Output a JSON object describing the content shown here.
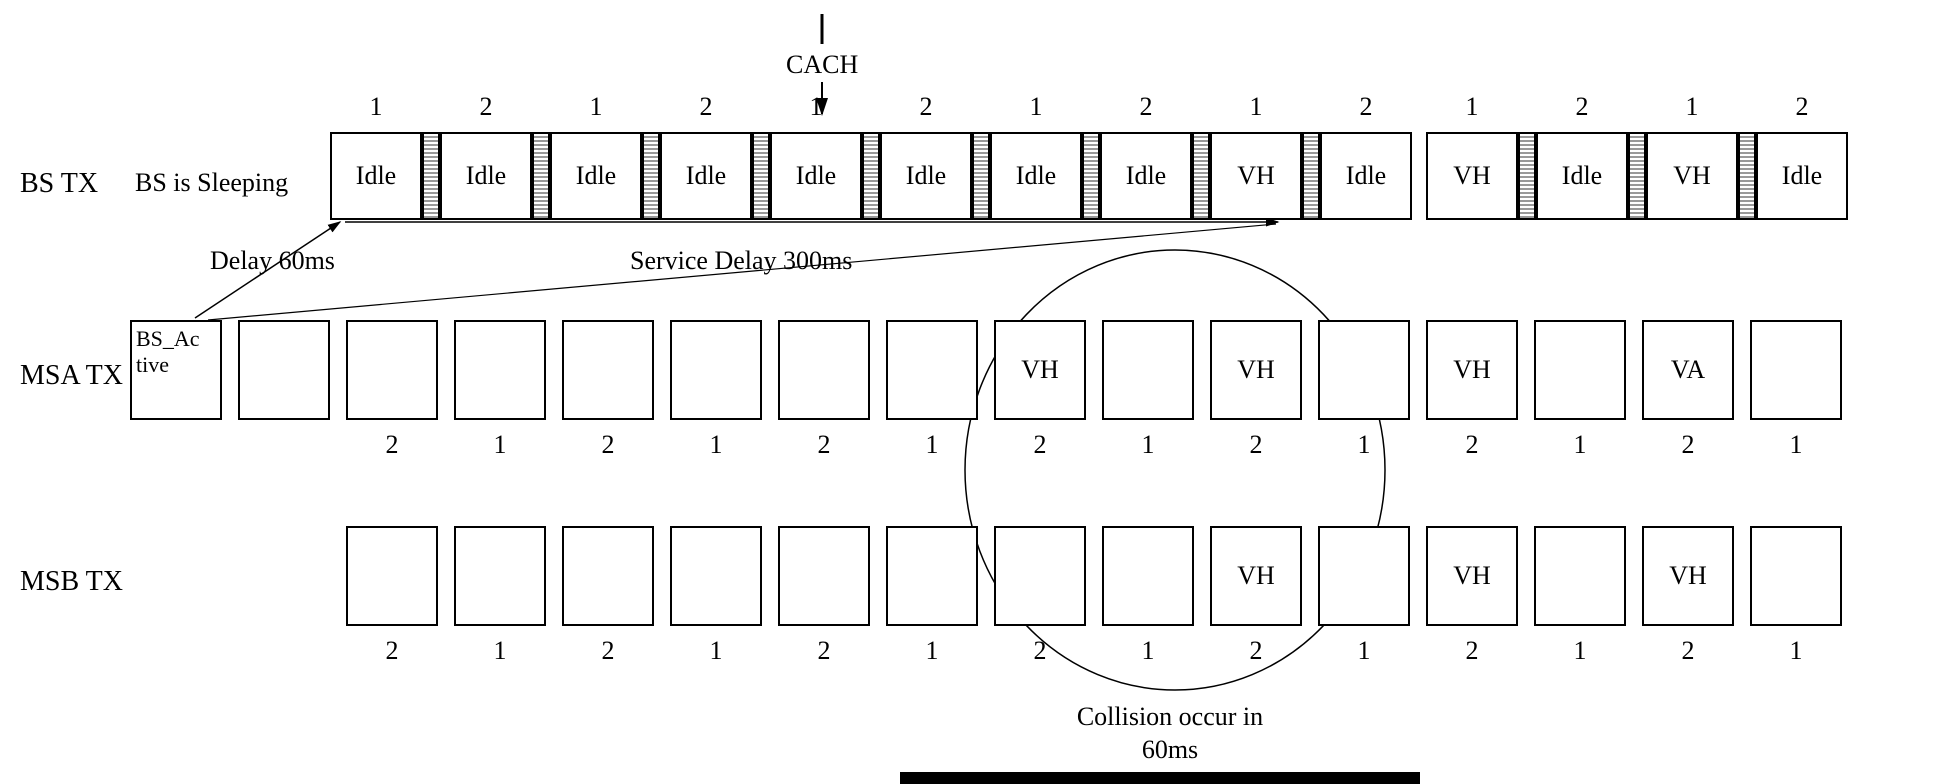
{
  "labels": {
    "bs_tx": "BS TX",
    "bs_sleeping": "BS is Sleeping",
    "msa_tx": "MSA TX",
    "msb_tx": "MSB TX",
    "cach": "CACH",
    "delay60": "Delay 60ms",
    "service_delay": "Service Delay 300ms",
    "collision1": "Collision occur in",
    "collision2": "60ms"
  },
  "bs_row": {
    "top_nums": [
      "1",
      "2",
      "1",
      "2",
      "1",
      "2",
      "1",
      "2",
      "1",
      "2",
      "1",
      "2",
      "1",
      "2"
    ],
    "slots": [
      "Idle",
      "Idle",
      "Idle",
      "Idle",
      "Idle",
      "Idle",
      "Idle",
      "Idle",
      "VH",
      "Idle",
      "VH",
      "Idle",
      "VH",
      "Idle"
    ]
  },
  "msa_row": {
    "bottom_nums": [
      "2",
      "1",
      "2",
      "1",
      "2",
      "1",
      "2",
      "1",
      "2",
      "1",
      "2",
      "1",
      "2",
      "1"
    ],
    "slots": [
      "BS_Ac\ntive",
      "",
      "",
      "",
      "",
      "",
      "",
      "",
      "VH",
      "",
      "VH",
      "",
      "VH",
      "",
      "VA",
      ""
    ]
  },
  "msb_row": {
    "bottom_nums": [
      "2",
      "1",
      "2",
      "1",
      "2",
      "1",
      "2",
      "1",
      "2",
      "1",
      "2",
      "1",
      "2",
      "1"
    ],
    "slots": [
      "",
      "",
      "",
      "",
      "",
      "",
      "",
      "",
      "VH",
      "",
      "VH",
      "",
      "VH",
      ""
    ]
  }
}
